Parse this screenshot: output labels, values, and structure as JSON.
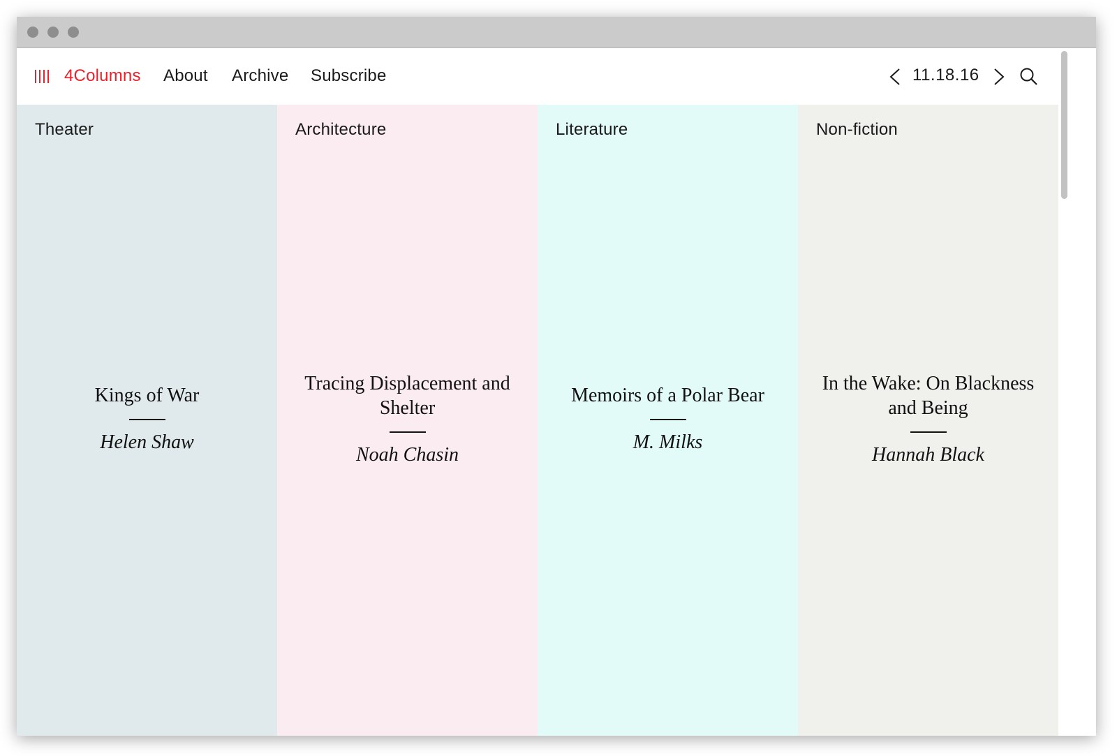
{
  "nav": {
    "brand": "4Columns",
    "links": [
      "About",
      "Archive",
      "Subscribe"
    ],
    "date": "11.18.16"
  },
  "columns": [
    {
      "category": "Theater",
      "title": "Kings of War",
      "author": "Helen Shaw",
      "bg": "#e0e9eb"
    },
    {
      "category": "Architecture",
      "title": "Tracing Displacement and Shelter",
      "author": "Noah Chasin",
      "bg": "#fbecf1"
    },
    {
      "category": "Literature",
      "title": "Memoirs of a Polar Bear",
      "author": "M. Milks",
      "bg": "#e2fbf8"
    },
    {
      "category": "Non-fiction",
      "title": "In the Wake: On Blackness and Being",
      "author": "Hannah Black",
      "bg": "#f0f0ec"
    }
  ],
  "colors": {
    "brand": "#e8212a",
    "titlebar": "#cbcbcb"
  }
}
